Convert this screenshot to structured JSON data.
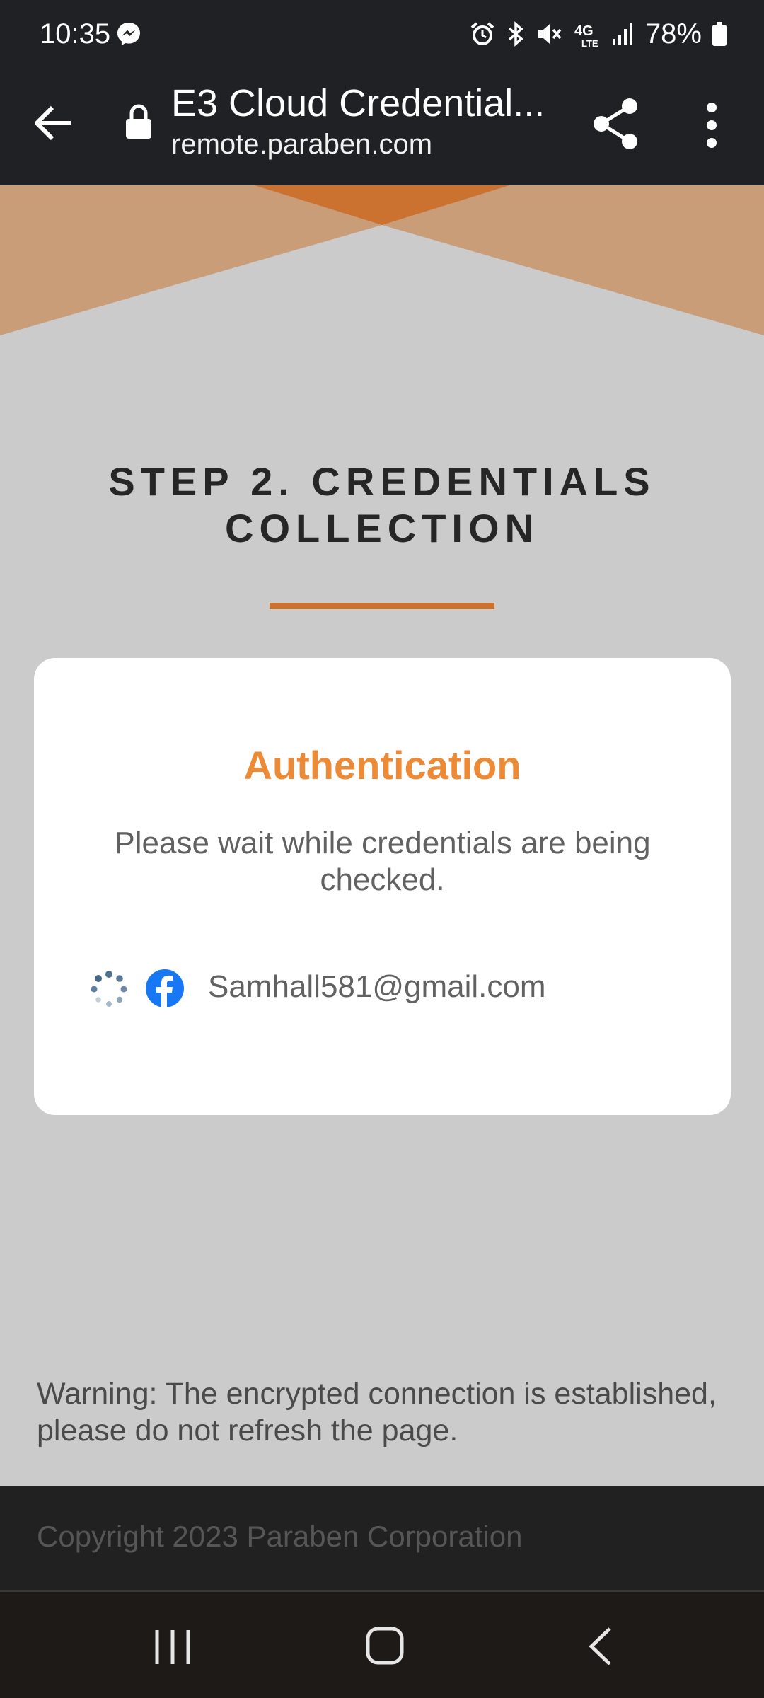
{
  "status_bar": {
    "time": "10:35",
    "battery": "78%",
    "icons": [
      "messenger-icon",
      "alarm-icon",
      "bluetooth-icon",
      "mute-icon",
      "4g-lte-icon",
      "signal-icon",
      "battery-icon"
    ]
  },
  "browser": {
    "page_title": "E3 Cloud Credential...",
    "url": "remote.paraben.com",
    "icons": [
      "back-arrow-icon",
      "lock-icon",
      "share-icon",
      "more-vert-icon"
    ]
  },
  "page": {
    "step_title_line1": "STEP 2. CREDENTIALS",
    "step_title_line2": "COLLECTION",
    "auth_title": "Authentication",
    "auth_message": "Please wait while credentials are being checked.",
    "account_email": "Samhall581@gmail.com",
    "account_icon": "facebook-icon",
    "warning": "Warning: The encrypted connection is established, please do not refresh the page.",
    "copyright": "Copyright 2023 Paraben Corporation"
  },
  "colors": {
    "accent": "#cc7230",
    "auth_title": "#ec8a35",
    "facebook": "#1877f2",
    "page_bg": "#cbcbcb",
    "chrome_bg": "#202124"
  },
  "nav_bar": {
    "icons": [
      "recents-icon",
      "home-icon",
      "back-icon"
    ]
  }
}
